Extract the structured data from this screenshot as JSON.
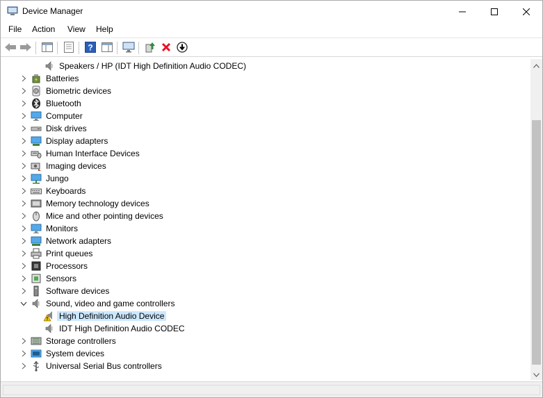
{
  "window": {
    "title": "Device Manager"
  },
  "menu": [
    "File",
    "Action",
    "View",
    "Help"
  ],
  "toolbar": {
    "buttons": [
      "back-icon",
      "forward-icon",
      "show-hide-console-tree-icon",
      "properties-icon",
      "help-icon",
      "action-pane-icon",
      "scan-hardware-icon",
      "update-driver-icon",
      "uninstall-icon",
      "disable-device-icon"
    ]
  },
  "tree": {
    "rows": [
      {
        "label": "Speakers / HP (IDT High Definition Audio CODEC)",
        "level": 2,
        "expander": "none",
        "icon": "speaker-icon"
      },
      {
        "label": "Batteries",
        "level": 1,
        "expander": "collapsed",
        "icon": "battery-icon"
      },
      {
        "label": "Biometric devices",
        "level": 1,
        "expander": "collapsed",
        "icon": "fingerprint-icon"
      },
      {
        "label": "Bluetooth",
        "level": 1,
        "expander": "collapsed",
        "icon": "bluetooth-icon"
      },
      {
        "label": "Computer",
        "level": 1,
        "expander": "collapsed",
        "icon": "computer-icon"
      },
      {
        "label": "Disk drives",
        "level": 1,
        "expander": "collapsed",
        "icon": "disk-drive-icon"
      },
      {
        "label": "Display adapters",
        "level": 1,
        "expander": "collapsed",
        "icon": "display-adapter-icon"
      },
      {
        "label": "Human Interface Devices",
        "level": 1,
        "expander": "collapsed",
        "icon": "hid-icon"
      },
      {
        "label": "Imaging devices",
        "level": 1,
        "expander": "collapsed",
        "icon": "camera-icon"
      },
      {
        "label": "Jungo",
        "level": 1,
        "expander": "collapsed",
        "icon": "monitor-network-icon"
      },
      {
        "label": "Keyboards",
        "level": 1,
        "expander": "collapsed",
        "icon": "keyboard-icon"
      },
      {
        "label": "Memory technology devices",
        "level": 1,
        "expander": "collapsed",
        "icon": "memory-icon"
      },
      {
        "label": "Mice and other pointing devices",
        "level": 1,
        "expander": "collapsed",
        "icon": "mouse-icon"
      },
      {
        "label": "Monitors",
        "level": 1,
        "expander": "collapsed",
        "icon": "monitor-icon"
      },
      {
        "label": "Network adapters",
        "level": 1,
        "expander": "collapsed",
        "icon": "network-adapter-icon"
      },
      {
        "label": "Print queues",
        "level": 1,
        "expander": "collapsed",
        "icon": "printer-icon"
      },
      {
        "label": "Processors",
        "level": 1,
        "expander": "collapsed",
        "icon": "processor-icon"
      },
      {
        "label": "Sensors",
        "level": 1,
        "expander": "collapsed",
        "icon": "sensor-icon"
      },
      {
        "label": "Software devices",
        "level": 1,
        "expander": "collapsed",
        "icon": "software-device-icon"
      },
      {
        "label": "Sound, video and game controllers",
        "level": 1,
        "expander": "expanded",
        "icon": "speaker-icon"
      },
      {
        "label": "High Definition Audio Device",
        "level": 2,
        "expander": "none",
        "icon": "warning-speaker-icon",
        "selected": true
      },
      {
        "label": "IDT High Definition Audio CODEC",
        "level": 2,
        "expander": "none",
        "icon": "speaker-icon"
      },
      {
        "label": "Storage controllers",
        "level": 1,
        "expander": "collapsed",
        "icon": "storage-controller-icon"
      },
      {
        "label": "System devices",
        "level": 1,
        "expander": "collapsed",
        "icon": "system-device-icon"
      },
      {
        "label": "Universal Serial Bus controllers",
        "level": 1,
        "expander": "collapsed",
        "icon": "usb-icon"
      }
    ]
  },
  "colors": {
    "selection": "#cce8ff",
    "warning": "#f5c400",
    "uninstall_red": "#e81123",
    "update_green": "#2e8b3d",
    "help_blue": "#2b5fb8"
  }
}
